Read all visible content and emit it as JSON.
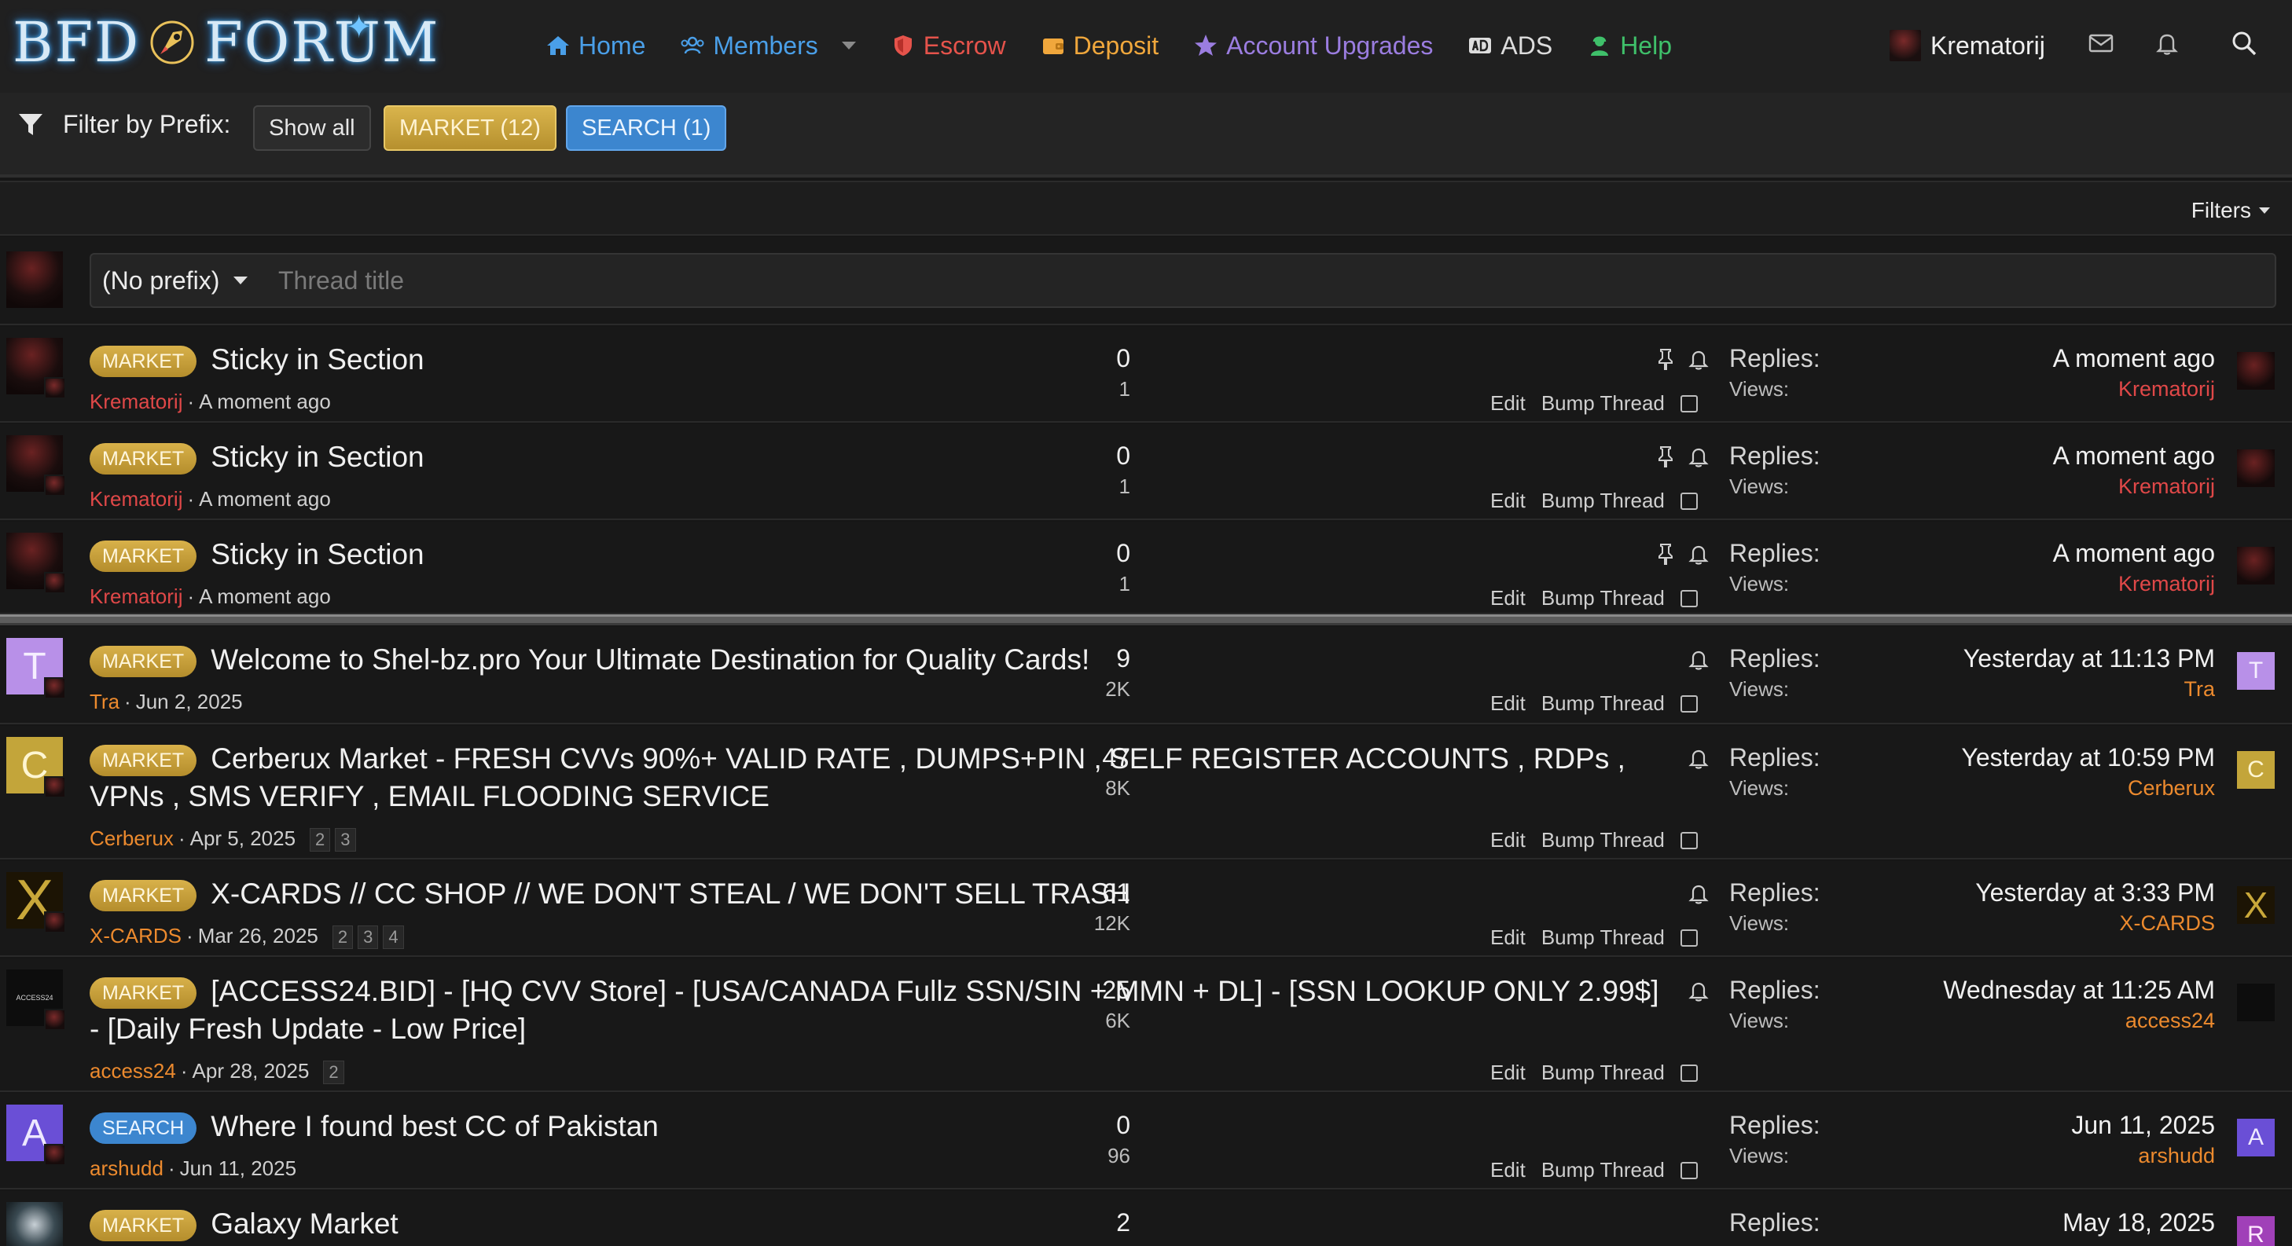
{
  "brand": {
    "logo_text_left": "BFD",
    "logo_text_right": "FORUM",
    "logo_star": "✦"
  },
  "nav": {
    "home": "Home",
    "members": "Members",
    "escrow": "Escrow",
    "deposit": "Deposit",
    "upgrades": "Account Upgrades",
    "ads": "ADS",
    "help": "Help"
  },
  "user": {
    "name": "Krematorij"
  },
  "prefix_filter": {
    "label": "Filter by Prefix:",
    "show_all": "Show all",
    "market": "MARKET (12)",
    "search": "SEARCH (1)"
  },
  "filters_label": "Filters",
  "quick_thread": {
    "prefix": "(No prefix)",
    "placeholder": "Thread title"
  },
  "labels": {
    "replies": "Replies:",
    "views": "Views:",
    "edit": "Edit",
    "bump": "Bump Thread",
    "separator": "·"
  },
  "colors": {
    "market_badge": "#c9a13b",
    "search_badge": "#3c86cf",
    "user_red": "#e04848",
    "user_orange": "#ec8a2e"
  },
  "threads": [
    {
      "prefix": "MARKET",
      "title": "Sticky in Section",
      "author": "Krematorij",
      "date": "A moment ago",
      "pages": [],
      "replies": "0",
      "views": "1",
      "last_date": "A moment ago",
      "last_user": "Krematorij",
      "sticky": true
    },
    {
      "prefix": "MARKET",
      "title": "Sticky in Section",
      "author": "Krematorij",
      "date": "A moment ago",
      "pages": [],
      "replies": "0",
      "views": "1",
      "last_date": "A moment ago",
      "last_user": "Krematorij",
      "sticky": true
    },
    {
      "prefix": "MARKET",
      "title": "Sticky in Section",
      "author": "Krematorij",
      "date": "A moment ago",
      "pages": [],
      "replies": "0",
      "views": "1",
      "last_date": "A moment ago",
      "last_user": "Krematorij",
      "sticky": true
    },
    {
      "prefix": "MARKET",
      "title": "Welcome to Shel-bz.pro Your Ultimate Destination for Quality Cards!",
      "author": "Tra",
      "date": "Jun 2, 2025",
      "avatar_letter": "T",
      "pages": [],
      "replies": "9",
      "views": "2K",
      "last_date": "Yesterday at 11:13 PM",
      "last_user": "Tra"
    },
    {
      "prefix": "MARKET",
      "title": "Cerberux Market - FRESH CVVs 90%+ VALID RATE , DUMPS+PIN , SELF REGISTER ACCOUNTS , RDPs , VPNs , SMS VERIFY , EMAIL FLOODING SERVICE",
      "author": "Cerberux",
      "date": "Apr 5, 2025",
      "avatar_letter": "C",
      "pages": [
        "2",
        "3"
      ],
      "replies": "47",
      "views": "8K",
      "last_date": "Yesterday at 10:59 PM",
      "last_user": "Cerberux"
    },
    {
      "prefix": "MARKET",
      "title": "X-CARDS // CC SHOP // WE DON'T STEAL / WE DON'T SELL TRASH",
      "author": "X-CARDS",
      "date": "Mar 26, 2025",
      "avatar_letter": "X",
      "pages": [
        "2",
        "3",
        "4"
      ],
      "replies": "61",
      "views": "12K",
      "last_date": "Yesterday at 3:33 PM",
      "last_user": "X-CARDS"
    },
    {
      "prefix": "MARKET",
      "title": "[ACCESS24.BID] - [HQ CVV Store] - [USA/CANADA Fullz SSN/SIN + MMN + DL] - [SSN LOOKUP ONLY 2.99$] - [Daily Fresh Update - Low Price]",
      "author": "access24",
      "date": "Apr 28, 2025",
      "avatar_letter": "ACCESS24",
      "pages": [
        "2"
      ],
      "replies": "25",
      "views": "6K",
      "last_date": "Wednesday at 11:25 AM",
      "last_user": "access24"
    },
    {
      "prefix": "SEARCH",
      "title": "Where I found best CC of Pakistan",
      "author": "arshudd",
      "date": "Jun 11, 2025",
      "avatar_letter": "A",
      "pages": [],
      "replies": "0",
      "views": "96",
      "last_date": "Jun 11, 2025",
      "last_user": "arshudd"
    },
    {
      "prefix": "MARKET",
      "title": "Galaxy Market",
      "author": "",
      "date": "",
      "pages": [],
      "replies": "2",
      "views": "",
      "last_date": "May 18, 2025",
      "last_user": "",
      "last_avatar_letter": "R"
    }
  ]
}
